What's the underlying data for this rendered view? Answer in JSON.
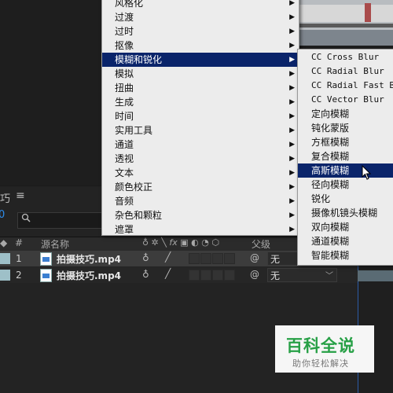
{
  "panel": {
    "tab_name": "巧",
    "menu_icon": "≡",
    "timecode": "0",
    "search_icon": "magnifier-icon"
  },
  "columns": {
    "hash": "#",
    "source_name": "源名称",
    "parent": "父级"
  },
  "layers": [
    {
      "num": "1",
      "name": "拍摄技巧.mp4",
      "parent": "无"
    },
    {
      "num": "2",
      "name": "拍摄技巧.mp4",
      "parent": "无"
    }
  ],
  "main_menu": {
    "items": [
      {
        "label": "风格化",
        "submenu": true
      },
      {
        "label": "过渡",
        "submenu": true
      },
      {
        "label": "过时",
        "submenu": true
      },
      {
        "label": "抠像",
        "submenu": true
      },
      {
        "label": "模糊和锐化",
        "submenu": true,
        "highlighted": true
      },
      {
        "label": "模拟",
        "submenu": true
      },
      {
        "label": "扭曲",
        "submenu": true
      },
      {
        "label": "生成",
        "submenu": true
      },
      {
        "label": "时间",
        "submenu": true
      },
      {
        "label": "实用工具",
        "submenu": true
      },
      {
        "label": "通道",
        "submenu": true
      },
      {
        "label": "透视",
        "submenu": true
      },
      {
        "label": "文本",
        "submenu": true
      },
      {
        "label": "颜色校正",
        "submenu": true
      },
      {
        "label": "音频",
        "submenu": true
      },
      {
        "label": "杂色和颗粒",
        "submenu": true
      },
      {
        "label": "遮罩",
        "submenu": true
      }
    ]
  },
  "sub_menu": {
    "items": [
      {
        "label": "CC Cross Blur",
        "mono": true
      },
      {
        "label": "CC Radial Blur",
        "mono": true
      },
      {
        "label": "CC Radial Fast Blu",
        "mono": true
      },
      {
        "label": "CC Vector Blur",
        "mono": true
      },
      {
        "label": "定向模糊"
      },
      {
        "label": "钝化蒙版"
      },
      {
        "label": "方框模糊"
      },
      {
        "label": "复合模糊"
      },
      {
        "label": "高斯模糊",
        "highlighted": true
      },
      {
        "label": "径向模糊"
      },
      {
        "label": "锐化"
      },
      {
        "label": "摄像机镜头模糊"
      },
      {
        "label": "双向模糊"
      },
      {
        "label": "通道模糊"
      },
      {
        "label": "智能模糊"
      }
    ]
  },
  "watermark": {
    "logo": "百科全说",
    "sub": "助你轻松解决"
  },
  "colors": {
    "highlight": "#0a246a",
    "menu_bg": "#ececec",
    "accent_blue": "#2d8ceb"
  }
}
